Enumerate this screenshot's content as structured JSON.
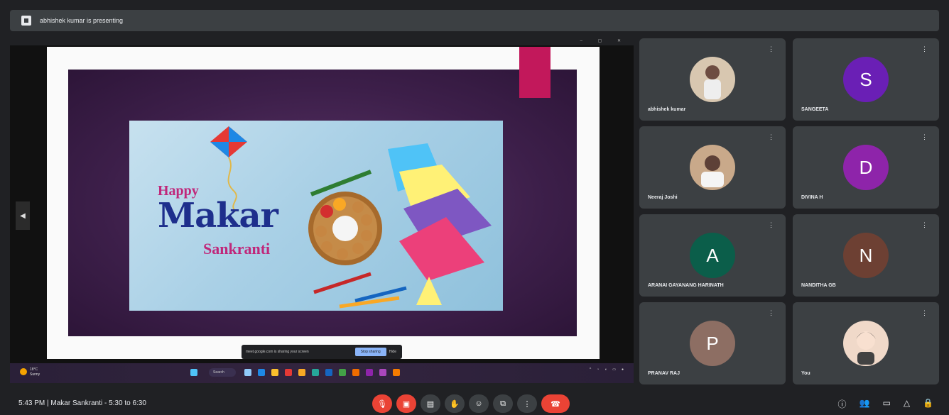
{
  "topbar": {
    "presenting_text": "abhishek kumar is presenting",
    "icon": "presentation-icon"
  },
  "shared_window": {
    "slide": {
      "happy": "Happy",
      "makar": "Makar",
      "sankranti": "Sankranti"
    },
    "share_notice": {
      "message": "meet.google.com is sharing your screen",
      "stop_label": "Stop sharing",
      "hide_label": "Hide"
    },
    "taskbar": {
      "weather_temp": "18°C",
      "weather_desc": "Sunny",
      "search_label": "Search"
    }
  },
  "participants": [
    {
      "name": "abhishek kumar",
      "initial": "",
      "avatar_color": "#d8c7b0"
    },
    {
      "name": "SANGEETA",
      "initial": "S",
      "avatar_color": "#6a1fb5"
    },
    {
      "name": "Neeraj Joshi",
      "initial": "",
      "avatar_color": "#c9a98a"
    },
    {
      "name": "DIVINA H",
      "initial": "D",
      "avatar_color": "#8e24aa"
    },
    {
      "name": "ARANAI GAYANANG HARINATH",
      "initial": "A",
      "avatar_color": "#0b5e4a"
    },
    {
      "name": "NANDITHA GB",
      "initial": "N",
      "avatar_color": "#6d4033"
    },
    {
      "name": "PRANAV RAJ",
      "initial": "P",
      "avatar_color": "#8d6e63"
    },
    {
      "name": "You",
      "initial": "",
      "avatar_color": "#f0d9c9"
    }
  ],
  "bottombar": {
    "meeting_info": "5:43 PM  |  Makar Sankranti - 5:30 to 6:30",
    "controls": [
      "mic-off-icon",
      "camera-off-icon",
      "captions-icon",
      "raise-hand-icon",
      "emoji-icon",
      "present-icon",
      "more-options-icon",
      "end-call-icon"
    ],
    "right": [
      "info-icon",
      "people-icon",
      "chat-icon",
      "activities-icon",
      "lock-icon"
    ]
  },
  "colors": {
    "accent_red": "#ea4335",
    "bg": "#202124",
    "tile": "#3c4043"
  }
}
